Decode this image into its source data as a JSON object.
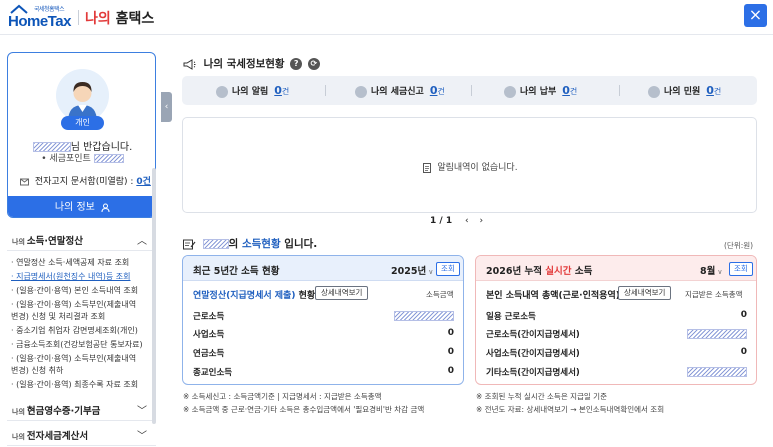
{
  "header": {
    "logo_small": "국세청홈택스",
    "logo_text": "HomeTax",
    "title_red": "나의",
    "title_rest": " 홈택스",
    "close_label": "×"
  },
  "profile": {
    "badge": "개인",
    "greeting": "님 반갑습니다.",
    "points_prefix": "• 세금포인트",
    "unread_label": "전자고지 문서함(미열람) : ",
    "unread_count": "0건",
    "myinfo_label": "나의 정보"
  },
  "menus": {
    "income": {
      "small": "나의",
      "label": "소득·연말정산"
    },
    "cash": {
      "small": "나의",
      "label": "현금영수증·기부금"
    },
    "tax_invoice": {
      "small": "나의",
      "label": "전자세금계산서"
    }
  },
  "submenu": [
    "· 연말정산 소득·세액공제 자료 조회",
    "· 지급명세서(원천징수 내역)등 조회",
    "· (일용·간이·용역) 본인 소득내역 조회",
    "· (일용·간이·용역) 소득부인(제출내역",
    "  변경) 신청 및 처리결과 조회",
    "· 중소기업 취업자 감면명세조회(개인)",
    "· 금융소득조회(건강보험공단 통보자료)",
    "· (일용·간이·용역) 소득부인(제출내역",
    "  변경) 신청 취하",
    "· (일용·간이·용역) 최종수록 자료 조회"
  ],
  "status": {
    "title": "나의 국세정보현황",
    "help_icon": "?",
    "items": [
      {
        "label": "나의 알림",
        "value": "0",
        "unit": "건"
      },
      {
        "label": "나의 세금신고",
        "value": "0",
        "unit": "건"
      },
      {
        "label": "나의 납부",
        "value": "0",
        "unit": "건"
      },
      {
        "label": "나의 민원",
        "value": "0",
        "unit": "건"
      }
    ]
  },
  "notice": {
    "empty_text": "알림내역이 없습니다.",
    "pager": "1 / 1"
  },
  "income": {
    "title_mid": "의 ",
    "title_blue": "소득현황",
    "title_end": " 입니다.",
    "unit": "(단위:원)",
    "left_card": {
      "title": "최근 5년간 소득 현황",
      "year": "2025년",
      "lookup": "조회",
      "sub_blue": "연말정산(지급명세서 제출)",
      "sub_rest": " 현황",
      "detail": "상세내역보기",
      "col": "소득금액",
      "rows": [
        {
          "label": "근로소득",
          "value": ""
        },
        {
          "label": "사업소득",
          "value": "0"
        },
        {
          "label": "연금소득",
          "value": "0"
        },
        {
          "label": "종교인소득",
          "value": "0"
        }
      ]
    },
    "right_card": {
      "title_pre": "2026년 누적 ",
      "title_red": "실시간",
      "title_post": " 소득",
      "month": "8월",
      "lookup": "조회",
      "sub": "본인 소득내역 총액(근로·인적용역)",
      "detail": "상세내역보기",
      "col": "지급받은 소득총액",
      "rows": [
        {
          "label": "일용 근로소득",
          "value": "0"
        },
        {
          "label": "근로소득(간이지급명세서)",
          "value": ""
        },
        {
          "label": "사업소득(간이지급명세서)",
          "value": "0"
        },
        {
          "label": "기타소득(간이지급명세서)",
          "value": ""
        }
      ]
    }
  },
  "footnotes": {
    "left1": "※ 소득세신고 : 소득금액기준  |  지급명세서 : 지급받은 소득총액",
    "left2": "※ 소득금액 중 근로·연금·기타 소득은 총수입금액에서 '필요경비'반 차감 금액",
    "right1": "※ 조회된 누적 실시간 소득은 지급일 기준",
    "right2": "※ 전년도 자료: 상세내역보기 → 본인소득내역확인에서 조회"
  },
  "colors": {
    "primary": "#2c6fe6",
    "accent_red": "#e23a3a",
    "link_blue": "#1f5fbf"
  }
}
